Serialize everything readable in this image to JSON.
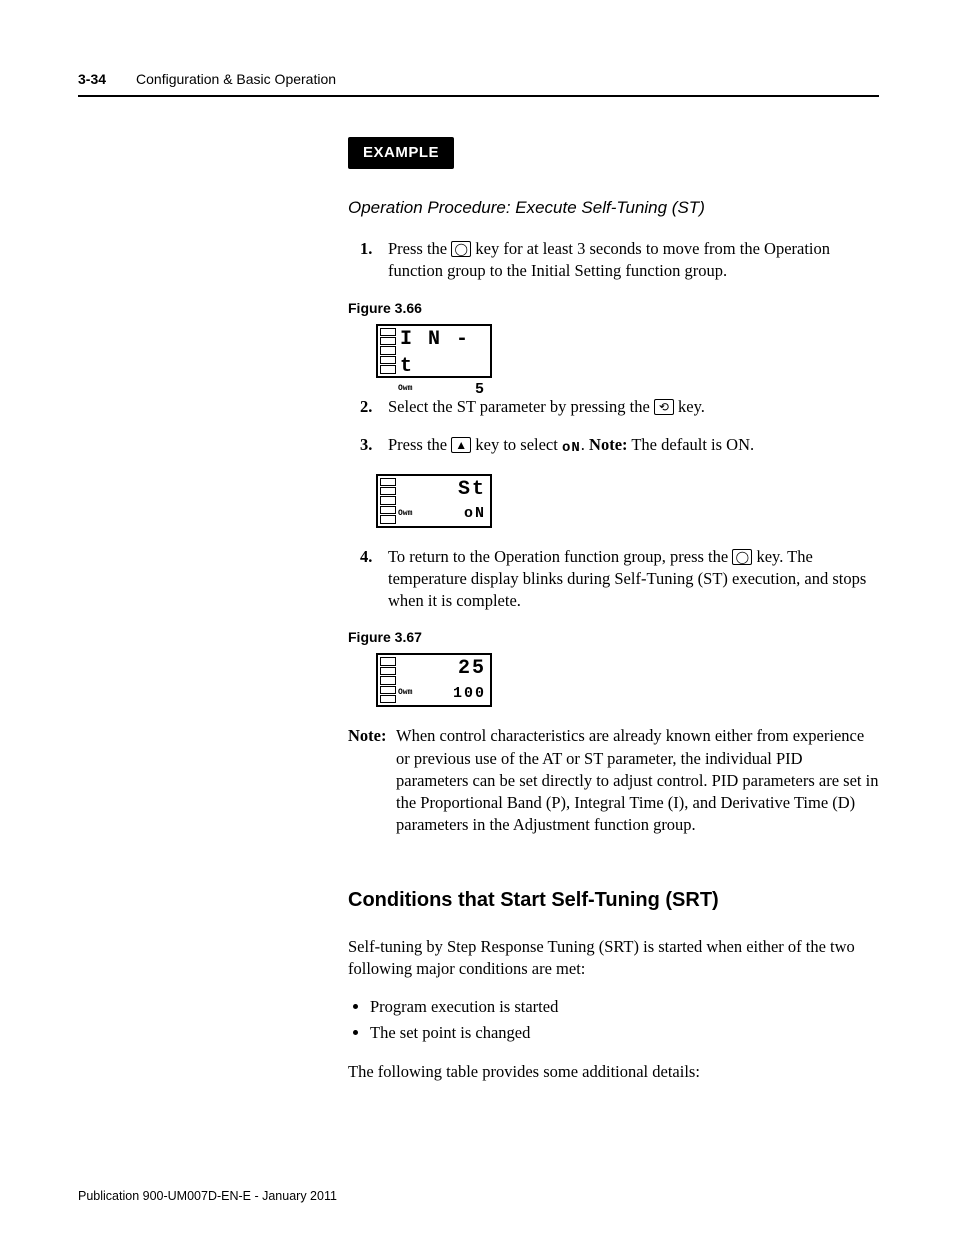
{
  "header": {
    "page_number": "3-34",
    "chapter_title": "Configuration & Basic Operation"
  },
  "example_label": "EXAMPLE",
  "procedure_title": "Operation Procedure: Execute Self-Tuning (ST)",
  "steps": {
    "s1_num": "1.",
    "s1a": "Press the ",
    "s1_key": "◯",
    "s1b": " key for at least 3 seconds to move from the Operation function group to the Initial Setting function group.",
    "s2_num": "2.",
    "s2a": "Select the ST parameter by pressing the ",
    "s2_key": "⟲",
    "s2b": " key.",
    "s3_num": "3.",
    "s3a": "Press the ",
    "s3_key": "▲",
    "s3b": " key to select ",
    "s3_seg": "oN",
    "s3c": ". ",
    "s3_note_label": "Note:",
    "s3d": " The default is ON.",
    "s4_num": "4.",
    "s4a": "To return to the Operation function group, press the ",
    "s4_key": "◯",
    "s4b": " key. The temperature display blinks during Self-Tuning (ST) execution, and stops when it is complete."
  },
  "figures": {
    "f366_label": "Figure 3.66",
    "f366_top": "I N - t",
    "f366_bot": "5",
    "fmid_top": "St",
    "fmid_bot": "oN",
    "f367_label": "Figure 3.67",
    "f367_top": "25",
    "f367_bot": "100"
  },
  "note": {
    "label": "Note:",
    "body": "When control characteristics are already known either from experience or previous use of the AT or ST parameter, the individual PID parameters can be set directly to adjust control. PID parameters are set in the Proportional Band (P), Integral Time (I), and Derivative Time (D) parameters in the Adjustment function group."
  },
  "section2": {
    "heading": "Conditions that Start Self-Tuning (SRT)",
    "intro": "Self-tuning by Step Response Tuning (SRT) is started when either of the two following major conditions are met:",
    "bullet1": "Program execution is started",
    "bullet2": "The set point is changed",
    "outro": "The following table provides some additional details:"
  },
  "footer": "Publication 900-UM007D-EN-E - January 2011",
  "owm": "Owm"
}
